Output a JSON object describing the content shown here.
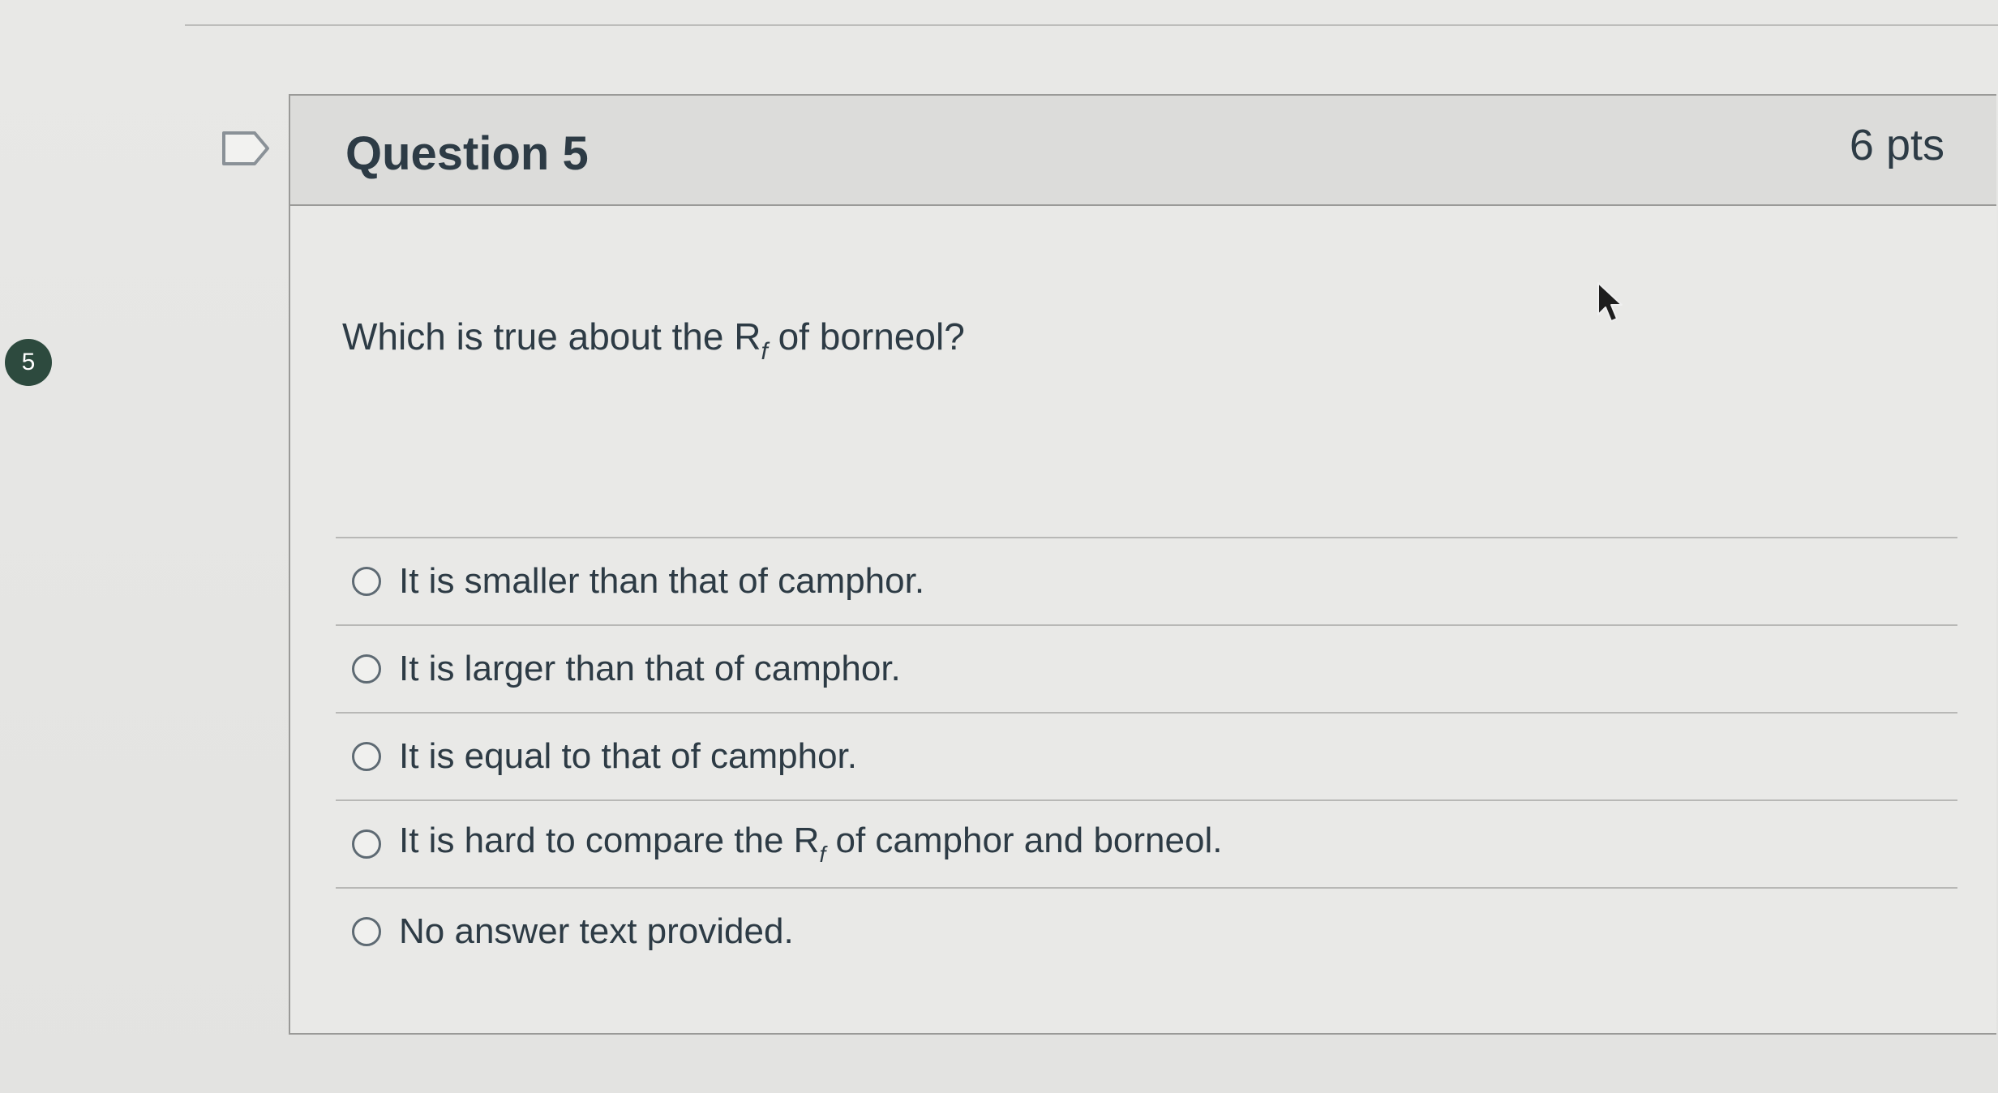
{
  "nav": {
    "question_number_badge": "5"
  },
  "question": {
    "title": "Question 5",
    "points": "6 pts",
    "prompt_prefix": "Which is true about the R",
    "prompt_sub": "f",
    "prompt_suffix": " of borneol?"
  },
  "answers": [
    {
      "label": "It is smaller than that of camphor."
    },
    {
      "label": "It is larger than that of camphor."
    },
    {
      "label": "It is equal to that of camphor."
    },
    {
      "label_prefix": "It is hard to compare the R",
      "label_sub": "f",
      "label_suffix": " of camphor and borneol."
    },
    {
      "label": "No answer text provided."
    }
  ],
  "icons": {
    "flag": "bookmark-flag-icon",
    "cursor": "mouse-pointer-icon",
    "radio": "radio-circle-icon"
  },
  "colors": {
    "text": "#2d3b45",
    "badge": "#2d4a3e",
    "header_bg": "#dcdcda",
    "border": "#9a9a98"
  }
}
